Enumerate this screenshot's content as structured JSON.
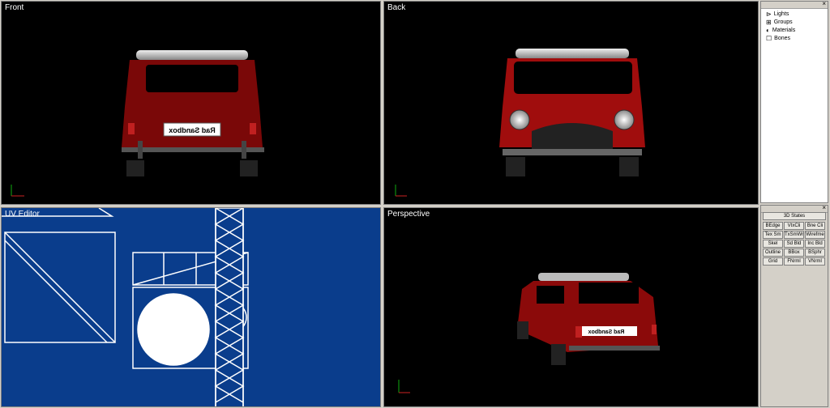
{
  "viewports": {
    "front": {
      "label": "Front",
      "plate_text": "Rad Sandbox"
    },
    "back": {
      "label": "Back"
    },
    "uv": {
      "label": "UV Editor"
    },
    "perspective": {
      "label": "Perspective",
      "plate_text": "Rad Sandbox"
    }
  },
  "scene_tree": {
    "items": [
      {
        "label": "Lights",
        "icon": "light-icon"
      },
      {
        "label": "Groups",
        "icon": "groups-icon"
      },
      {
        "label": "Materials",
        "icon": "materials-icon"
      },
      {
        "label": "Bones",
        "icon": "bones-icon"
      }
    ]
  },
  "states_panel": {
    "header": "3D States",
    "buttons": [
      [
        "BEdge",
        "VtxCli",
        "Bne Cli"
      ],
      [
        "Tex Sm",
        "TxSmWr",
        "Wirefme"
      ],
      [
        "Skel",
        "Sd Bld",
        "Inc Bld"
      ],
      [
        "Outline",
        "BBox",
        "BSphr"
      ],
      [
        "Grid",
        "FNrml",
        "VNrml"
      ]
    ]
  },
  "colors": {
    "car_red": "#8b0a0a",
    "uv_background": "#0a3d8c",
    "viewport_bg": "#000000"
  }
}
